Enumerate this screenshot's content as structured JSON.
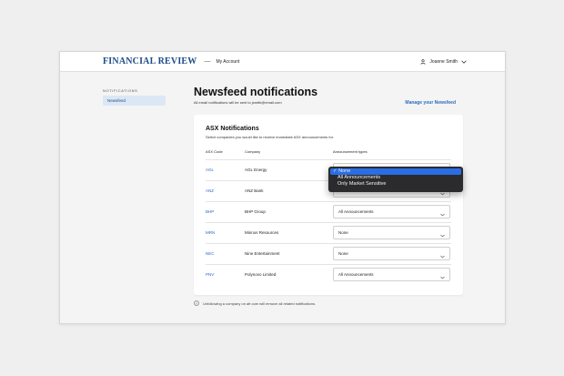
{
  "header": {
    "logo": "FINANCIAL REVIEW",
    "separator": "—",
    "breadcrumb": "My Account",
    "user_name": "Joanne Smith"
  },
  "sidebar": {
    "heading": "NOTIFICATIONS",
    "items": [
      {
        "label": "Newsfeed",
        "active": true
      }
    ]
  },
  "main": {
    "title": "Newsfeed notifications",
    "subtitle": "All email notifications will be sent to jsmith@email.com",
    "manage_link": "Manage your Newsfeed"
  },
  "card": {
    "title": "ASX Notifications",
    "description": "Select companies you would like to receive immediate ASX announcements for.",
    "columns": [
      "ASX Code",
      "Company",
      "Announcement types"
    ],
    "rows": [
      {
        "code": "AGL",
        "company": "AGL Energy",
        "announcement": "None"
      },
      {
        "code": "ANZ",
        "company": "ANZ Bank",
        "announcement": "None"
      },
      {
        "code": "BHP",
        "company": "BHP Group",
        "announcement": "All Announcements"
      },
      {
        "code": "MRN",
        "company": "Minnos Resources",
        "announcement": "None"
      },
      {
        "code": "NEC",
        "company": "Nine Entertainment",
        "announcement": "None"
      },
      {
        "code": "PNV",
        "company": "Polynovo Limited",
        "announcement": "All Announcements"
      }
    ]
  },
  "footer_note": "Unfollowing a company on afr.com will remove all related notifications.",
  "dropdown": {
    "options": [
      {
        "label": "✓ None",
        "selected": true
      },
      {
        "label": "All Announcements",
        "selected": false
      },
      {
        "label": "Only Market Sensitive",
        "selected": false
      }
    ]
  },
  "colors": {
    "brand": "#1b4a8a",
    "link": "#2a6bc2",
    "selected_option": "#2a6ee6",
    "sidebar_active": "#dbe7f4"
  }
}
